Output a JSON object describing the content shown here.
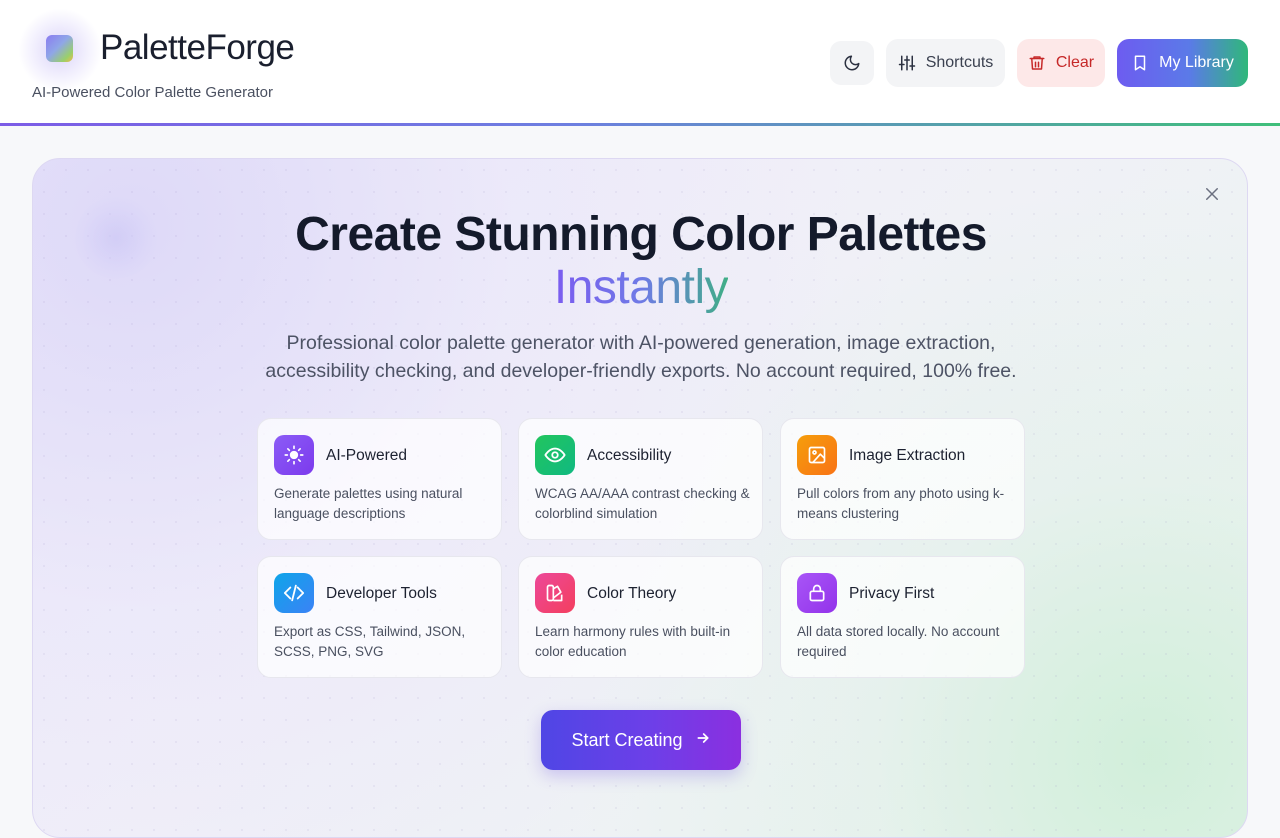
{
  "header": {
    "app_title": "PaletteForge",
    "app_subtitle": "AI-Powered Color Palette Generator",
    "buttons": {
      "theme_icon": "moon-icon",
      "shortcuts_label": "Shortcuts",
      "clear_label": "Clear",
      "library_label": "My Library"
    }
  },
  "hero": {
    "title_line1": "Create Stunning Color Palettes",
    "title_line2": "Instantly",
    "description": "Professional color palette generator with AI-powered generation, image extraction, accessibility checking, and developer-friendly exports. No account required, 100% free.",
    "features": [
      {
        "title": "AI-Powered",
        "desc": "Generate palettes using natural language descriptions",
        "icon": "sun-icon",
        "color": "#8b5cf6"
      },
      {
        "title": "Accessibility",
        "desc": "WCAG AA/AAA contrast checking & colorblind simulation",
        "icon": "eye-icon",
        "color": "#22c55e"
      },
      {
        "title": "Image Extraction",
        "desc": "Pull colors from any photo using k-means clustering",
        "icon": "image-icon",
        "color": "#f59e0b"
      },
      {
        "title": "Developer Tools",
        "desc": "Export as CSS, Tailwind, JSON, SCSS, PNG, SVG",
        "icon": "code-icon",
        "color": "#0ea5e9"
      },
      {
        "title": "Color Theory",
        "desc": "Learn harmony rules with built-in color education",
        "icon": "swatch-icon",
        "color": "#ec4899"
      },
      {
        "title": "Privacy First",
        "desc": "All data stored locally. No account required",
        "icon": "lock-icon",
        "color": "#a855f7"
      }
    ],
    "cta_label": "Start Creating"
  },
  "colors": {
    "accent": "#6d5cf0",
    "danger": "#c62828",
    "success": "#2fb87a"
  }
}
